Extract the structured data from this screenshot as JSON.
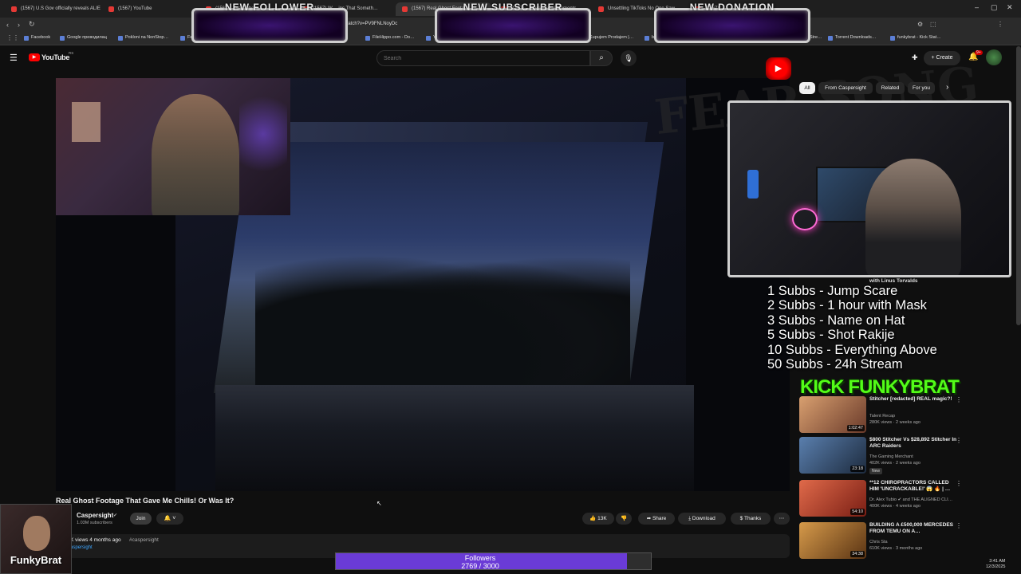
{
  "browser": {
    "tabs": [
      {
        "label": "(1567) U.S Gov officially reveals ALIEN…"
      },
      {
        "label": "(1567) YouTube"
      },
      {
        "label": "(1567) …YouTube"
      },
      {
        "label": "(1567) W… ins That Someth…"
      },
      {
        "label": "(1567) Real Ghost Footage"
      },
      {
        "label": "(1567) …Paranormal Moments"
      },
      {
        "label": "Unsettling TikToks No One Saw…"
      },
      {
        "label": "(1567) …"
      }
    ],
    "address": "watch?v=PV9FNLNoyDc",
    "bookmarks": [
      {
        "label": "Facebook"
      },
      {
        "label": "Google преводилац"
      },
      {
        "label": "Pokloni na NonStop…"
      },
      {
        "label": "Festiv…"
      },
      {
        "label": "FileHippo.com - Do…"
      },
      {
        "label": "You…"
      },
      {
        "label": "Kupujem Prodajem |…"
      },
      {
        "label": "bet…"
      },
      {
        "label": "Stre…"
      },
      {
        "label": "Torrent Downloads…"
      },
      {
        "label": "funkybrat - Kick Stat…"
      }
    ]
  },
  "alerts": {
    "follower": "NEW FOLLOWER",
    "subscriber": "NEW SUBSCRIBER",
    "donation": "NEW DONATION"
  },
  "youtube": {
    "logo": "YouTube",
    "logo_country": "RS",
    "search_placeholder": "Search",
    "create_label": "Create",
    "notifications_badge": "9+"
  },
  "chips": [
    {
      "label": "All",
      "active": true
    },
    {
      "label": "From Caspersight",
      "active": false
    },
    {
      "label": "Related",
      "active": false
    },
    {
      "label": "For you",
      "active": false
    }
  ],
  "overlay": {
    "ghost_text": "FEAR SONG",
    "rewards": [
      "1 Subbs - Jump Scare",
      "2 Subbs - 1 hour with Mask",
      "3 Subbs - Name on Hat",
      "5 Subbs - Shot Rakije",
      "10 Subbs - Everything Above",
      "50 Subbs - 24h Stream"
    ],
    "kick_logo": "KICK FUNKYBRAT",
    "streamer_name": "FunkyBrat",
    "followers_label": "Followers",
    "followers_count": "2769 / 3000",
    "followers_current": 2769,
    "followers_goal": 3000,
    "hidden_rec_title": "with Linus Torvalds"
  },
  "recommendations": [
    {
      "title": "Stitcher [redacted] REAL magic?!",
      "channel": "Talent Recap",
      "meta": "280K views · 2 weeks ago",
      "duration": "1:02:47",
      "thumb_color": "#c77a4a"
    },
    {
      "title": "$800 Stitcher Vs $28,892 Stitcher In ARC Raiders",
      "channel": "The Gaming Merchant",
      "meta": "402K views · 2 weeks ago",
      "duration": "23:18",
      "thumb_color": "#3b5e86",
      "badge": "New"
    },
    {
      "title": "**12 CHIROPRACTORS CALLED HIM 'UNCRACKABLE!' 😱 🔥 | …",
      "channel": "Dr. Alex Tubio ✔ and THE ALIGNED CLI…",
      "meta": "400K views · 4 weeks ago",
      "duration": "54:10",
      "thumb_color": "#c94c3c"
    },
    {
      "title": "BUILDING A £500,000 MERCEDES FROM TEMU ON A…",
      "channel": "Chris Sta",
      "meta": "610K views · 3 months ago",
      "duration": "34:38",
      "thumb_color": "#b07a3a"
    }
  ],
  "video": {
    "title": "Real Ghost Footage That Gave Me Chills! Or Was It?",
    "channel": "Caspersight",
    "subscribers": "1.03M subscribers",
    "join_label": "Join",
    "likes": "13K",
    "share_label": "Share",
    "download_label": "Download",
    "thanks_label": "Thanks",
    "views": "K views  4 months ago",
    "hashtag": "#caspersight",
    "desc_link": "aspersight"
  },
  "clock": {
    "time": "3:41 AM",
    "date": "12/3/2025"
  },
  "colors": {
    "youtube_red": "#ff0000",
    "kick_green": "#53fc18",
    "followers_bar": "#6a3bd6",
    "alert_purple": "#3a1470"
  }
}
